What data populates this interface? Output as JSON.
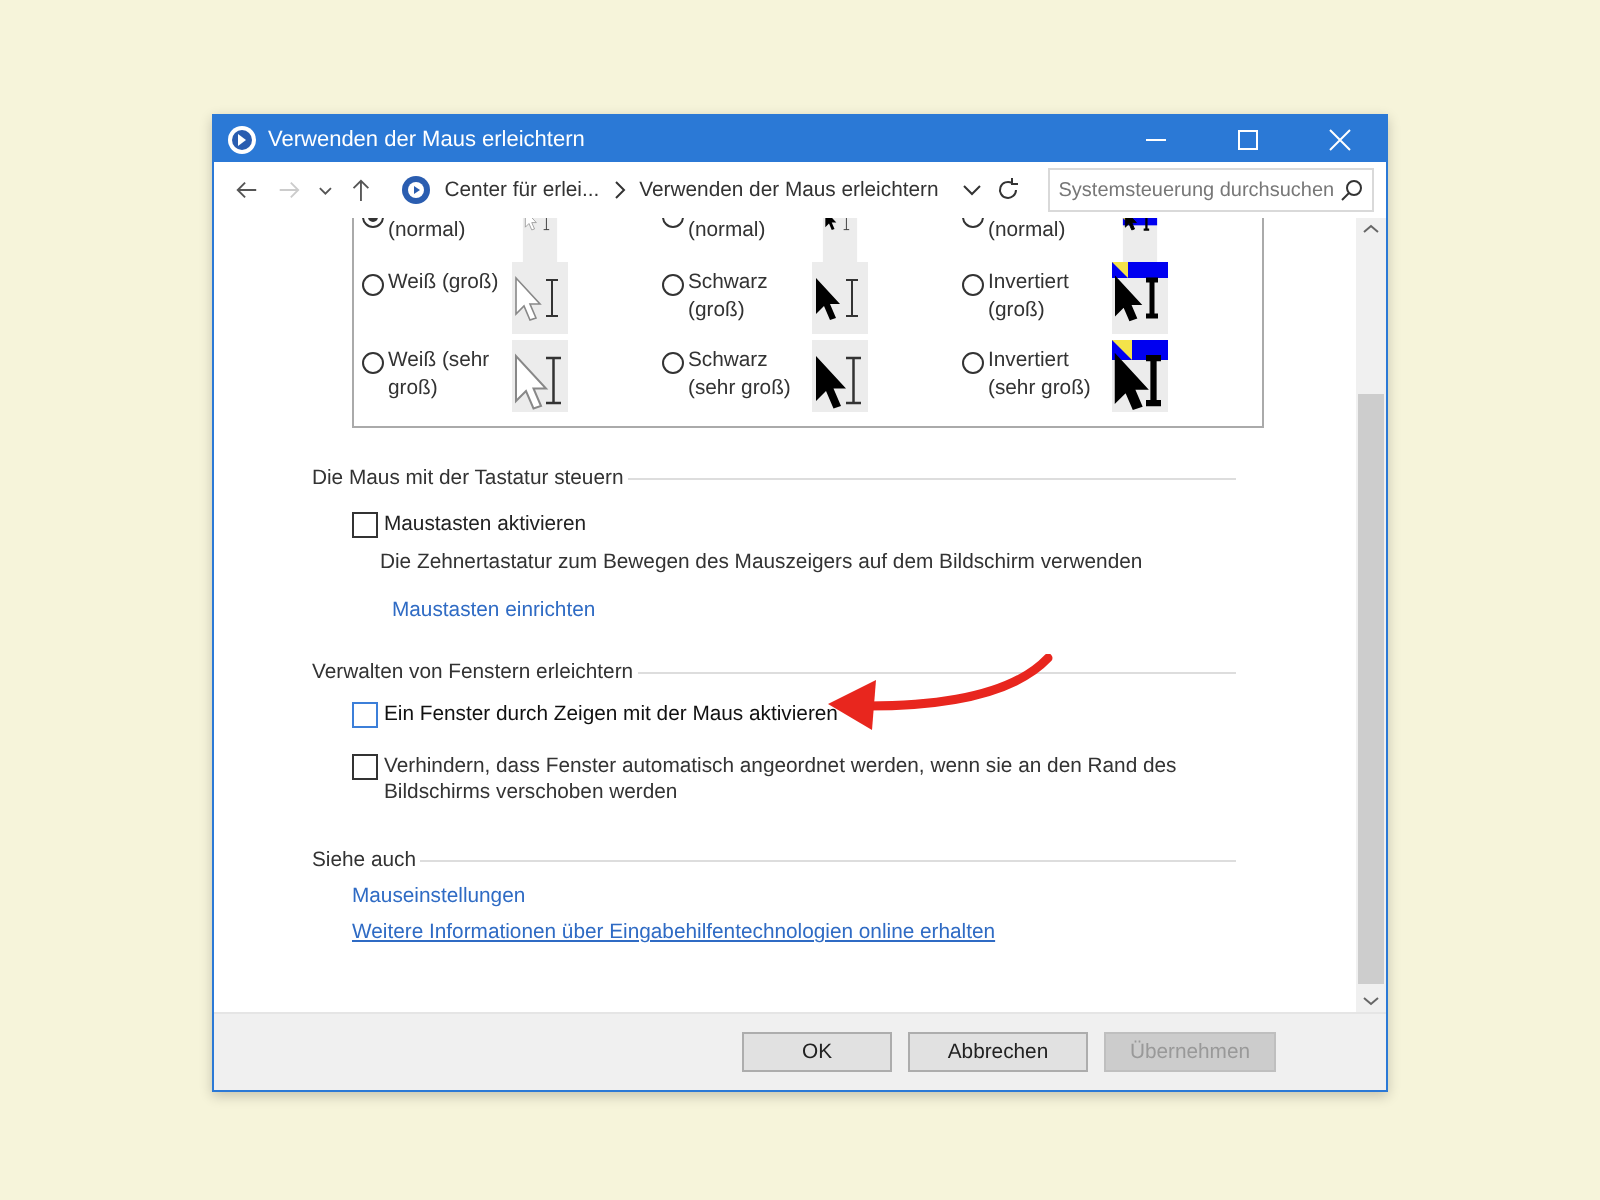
{
  "window": {
    "title": "Verwenden der Maus erleichtern"
  },
  "address_bar": {
    "breadcrumbs": [
      "Center für erlei...",
      "Verwenden der Maus erleichtern"
    ],
    "search": {
      "placeholder": "Systemsteuerung durchsuchen"
    }
  },
  "cursor_schemes": [
    {
      "label": "(normal)",
      "selected": true,
      "kind": "white",
      "clipped": true
    },
    {
      "label": "(normal)",
      "selected": false,
      "kind": "black",
      "clipped": true
    },
    {
      "label": "(normal)",
      "selected": false,
      "kind": "inverted",
      "clipped": true
    },
    {
      "label": "Weiß (groß)",
      "selected": false,
      "kind": "white",
      "clipped": false
    },
    {
      "label": "Schwarz (groß)",
      "selected": false,
      "kind": "black",
      "clipped": false
    },
    {
      "label": "Invertiert (groß)",
      "selected": false,
      "kind": "inverted",
      "clipped": false
    },
    {
      "label": "Weiß (sehr groß)",
      "selected": false,
      "kind": "white",
      "clipped": false
    },
    {
      "label": "Schwarz (sehr groß)",
      "selected": false,
      "kind": "black",
      "clipped": false
    },
    {
      "label": "Invertiert (sehr groß)",
      "selected": false,
      "kind": "inverted",
      "clipped": false
    }
  ],
  "keyboard_section": {
    "heading": "Die Maus mit der Tastatur steuern",
    "checkbox": {
      "label": "Maustasten aktivieren",
      "checked": false
    },
    "description": "Die Zehnertastatur zum Bewegen des Mauszeigers auf dem Bildschirm verwenden",
    "link": "Maustasten einrichten"
  },
  "windows_section": {
    "heading": "Verwalten von Fenstern erleichtern",
    "options": [
      {
        "label": "Ein Fenster durch Zeigen mit der Maus aktivieren",
        "checked": false,
        "focused": true
      },
      {
        "label": "Verhindern, dass Fenster automatisch angeordnet werden, wenn sie an den Rand des Bildschirms verschoben werden",
        "checked": false,
        "focused": false
      }
    ]
  },
  "see_also": {
    "heading": "Siehe auch",
    "links": [
      {
        "text": "Mauseinstellungen",
        "hovered": false
      },
      {
        "text": "Weitere Informationen über Eingabehilfentechnologien online erhalten",
        "hovered": true
      }
    ]
  },
  "buttons": [
    {
      "label": "OK",
      "disabled": false
    },
    {
      "label": "Abbrechen",
      "disabled": false
    },
    {
      "label": "Übernehmen",
      "disabled": true
    }
  ]
}
